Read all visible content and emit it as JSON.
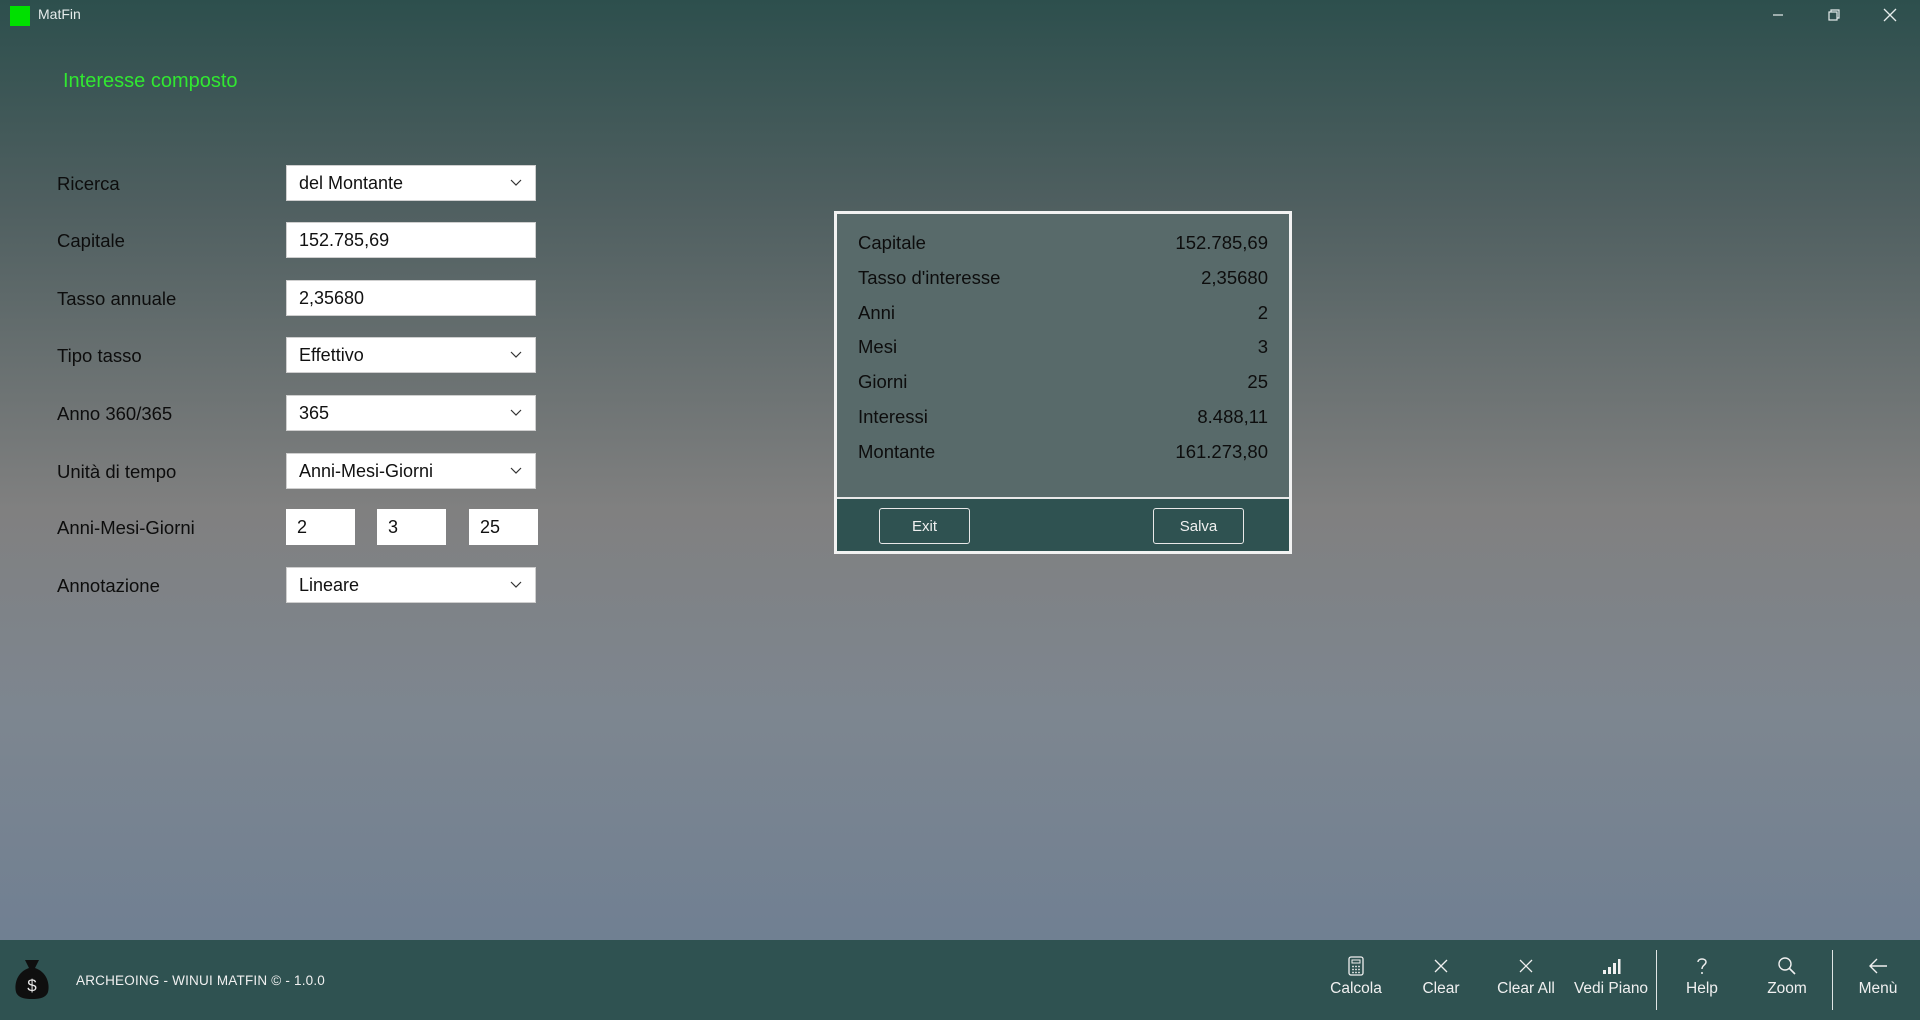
{
  "window": {
    "app_title": "MatFin",
    "controls": [
      "minimize-icon",
      "restore-icon",
      "close-icon"
    ]
  },
  "page_title": "Interesse composto",
  "form": {
    "ricerca": {
      "label": "Ricerca",
      "value": "del Montante"
    },
    "capitale": {
      "label": "Capitale",
      "value": "152.785,69"
    },
    "tasso_annuale": {
      "label": "Tasso annuale",
      "value": "2,35680"
    },
    "tipo_tasso": {
      "label": "Tipo tasso",
      "value": "Effettivo"
    },
    "anno": {
      "label": "Anno 360/365",
      "value": "365"
    },
    "unita_tempo": {
      "label": "Unità di tempo",
      "value": "Anni-Mesi-Giorni"
    },
    "anni_mesi_giorni": {
      "label": "Anni-Mesi-Giorni",
      "anni": "2",
      "mesi": "3",
      "giorni": "25"
    },
    "annotazione": {
      "label": "Annotazione",
      "value": "Lineare"
    }
  },
  "results": {
    "rows": [
      {
        "label": "Capitale",
        "value": "152.785,69"
      },
      {
        "label": "Tasso d'interesse",
        "value": "2,35680"
      },
      {
        "label": "Anni",
        "value": "2"
      },
      {
        "label": "Mesi",
        "value": "3"
      },
      {
        "label": "Giorni",
        "value": "25"
      },
      {
        "label": "Interessi",
        "value": "8.488,11"
      },
      {
        "label": "Montante",
        "value": "161.273,80"
      }
    ],
    "exit_label": "Exit",
    "save_label": "Salva"
  },
  "footer": {
    "text": "ARCHEOING - WINUI MATFIN © - 1.0.0",
    "commands": [
      {
        "label": "Calcola",
        "icon": "calculator-icon"
      },
      {
        "label": "Clear",
        "icon": "clear-icon"
      },
      {
        "label": "Clear All",
        "icon": "clear-all-icon"
      },
      {
        "label": "Vedi Piano",
        "icon": "bar-chart-icon"
      },
      {
        "label": "Help",
        "icon": "help-icon"
      },
      {
        "label": "Zoom",
        "icon": "zoom-icon"
      },
      {
        "label": "Menù",
        "icon": "back-arrow-icon"
      }
    ]
  },
  "colors": {
    "accent_title": "#31e831",
    "bar_background": "#2f5251",
    "app_icon": "#00e000"
  }
}
